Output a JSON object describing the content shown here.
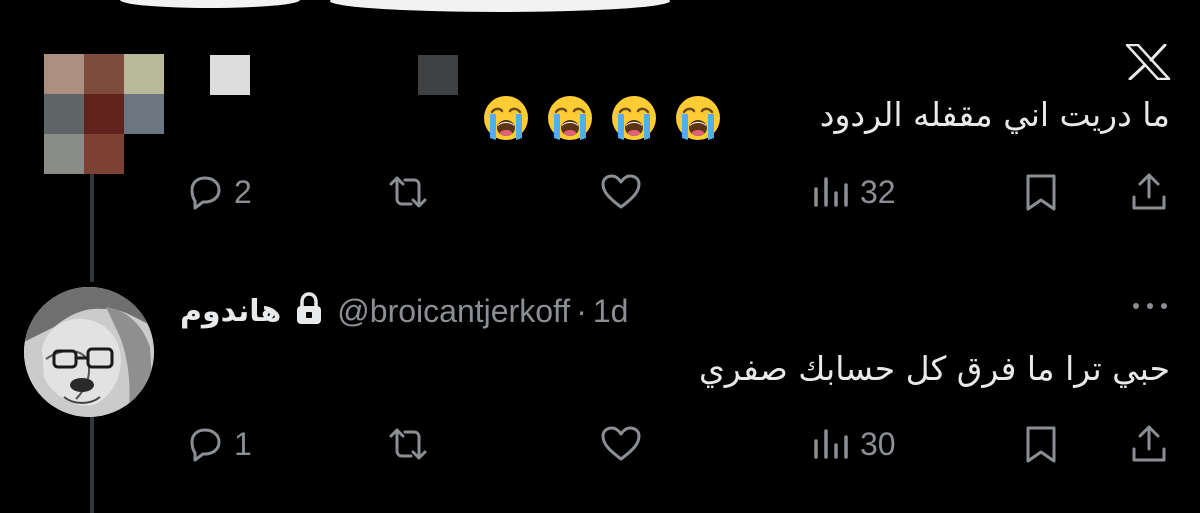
{
  "tweet1": {
    "text": "ما دريت اني مقفله الردود",
    "emoji_count": 4,
    "emoji_name": "loudly-crying-face",
    "actions": {
      "replies": "2",
      "views": "32"
    }
  },
  "tweet2": {
    "display_name": "هاندوم",
    "handle": "@broicantjerkoff",
    "separator": "·",
    "time": "1d",
    "text": "حبي ترا ما فرق كل حسابك صفري",
    "actions": {
      "replies": "1",
      "views": "30"
    }
  },
  "colors": {
    "background": "#000000",
    "text": "#e7e9ea",
    "secondary": "#8b8f93",
    "thread_line": "#333639"
  },
  "icons": [
    "x-logo-icon",
    "reply-icon",
    "retweet-icon",
    "like-icon",
    "views-icon",
    "bookmark-icon",
    "share-icon",
    "lock-icon",
    "more-icon"
  ]
}
